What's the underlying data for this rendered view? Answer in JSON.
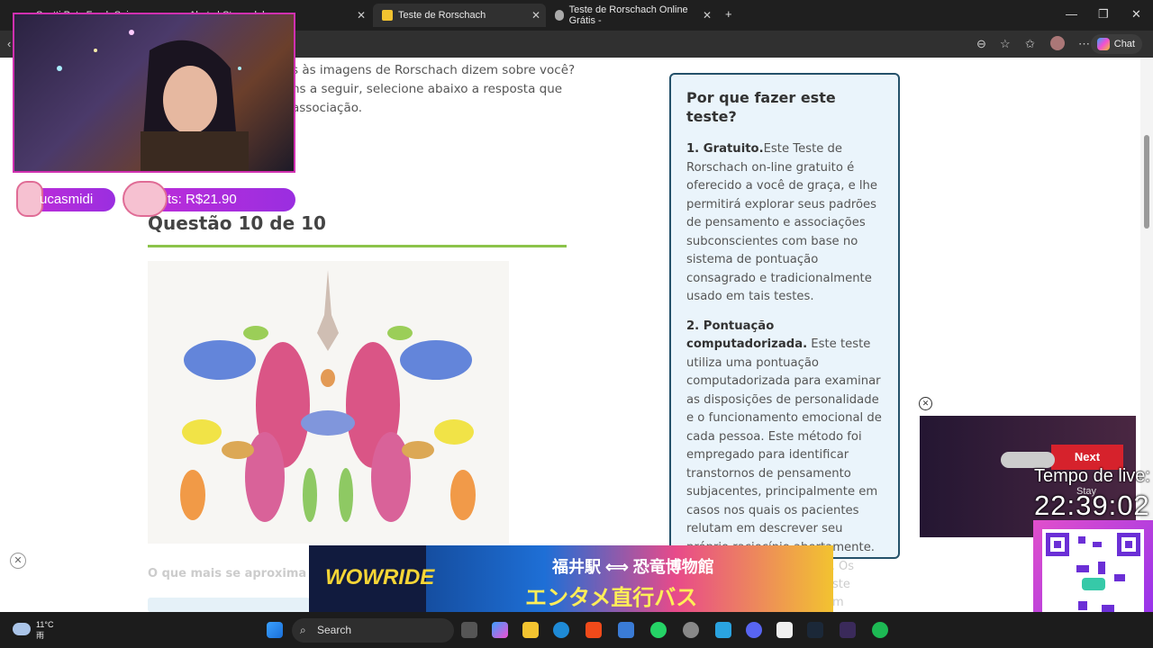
{
  "browser": {
    "tabs": [
      {
        "label": "Scotti Puts Fresh Spin"
      },
      {
        "label": "Alerts | Streamlabs"
      },
      {
        "label": "Teste de Rorschach"
      },
      {
        "label": "Teste de Rorschach Online Grátis -"
      }
    ],
    "chat_label": "Chat",
    "new_tab": "+"
  },
  "page": {
    "intro": "s às imagens de Rorschach dizem sobre você? ns a seguir, selecione abaixo a resposta que associação.",
    "question_title": "Questão 10 de 10",
    "bottom_question": "O que mais se aproxima d",
    "bottom_right": "s. Os\neste\nem"
  },
  "sidebar": {
    "title": "Por que fazer este teste?",
    "p1_bold": "1. Gratuito.",
    "p1_text": "Este Teste de Rorschach on-line gratuito é oferecido a você de graça, e lhe permitirá explorar seus padrões de pensamento e associações subconscientes com base no sistema de pontuação consagrado e tradicionalmente usado em tais testes.",
    "p2_bold": "2. Pontuação computadorizada.",
    "p2_text": " Este teste utiliza uma pontuação computadorizada para examinar as disposições de personalidade e o funcionamento emocional de cada pessoa. Este método foi empregado para identificar transtornos de pensamento subjacentes, principalmente em casos nos quais os pacientes relutam em descrever seu próprio raciocínio abertamente."
  },
  "ad": {
    "logo": "WOWRIDE",
    "line1": "福井駅 ⟺ 恐竜博物館",
    "line2": "エンタメ直行バス"
  },
  "stream": {
    "username": "ucasmidi",
    "donations": "ts: R$21.90",
    "live_label": "Tempo de live:",
    "live_time": "22:39:02"
  },
  "video": {
    "next_label": "Next",
    "stay_label": "Stay"
  },
  "taskbar": {
    "temp": "11°C",
    "weather": "雨",
    "search": "Search"
  }
}
